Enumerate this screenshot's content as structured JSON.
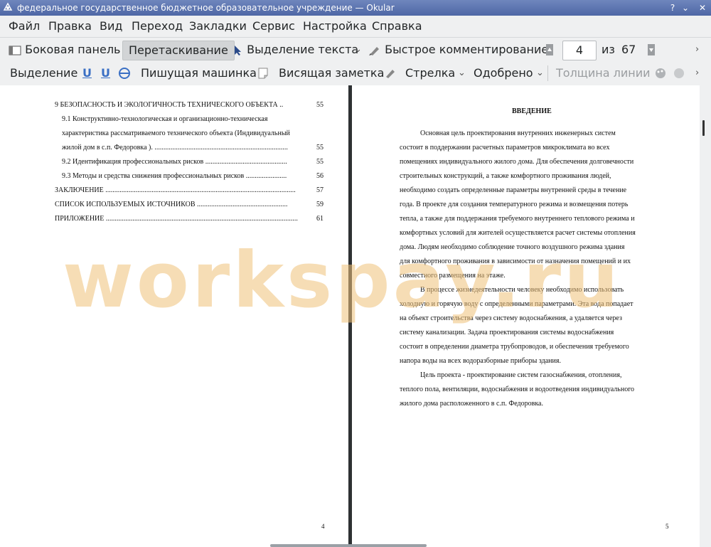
{
  "window": {
    "title": "федеральное государственное бюджетное образовательное учреждение  — Okular"
  },
  "menu": [
    "Файл",
    "Правка",
    "Вид",
    "Переход",
    "Закладки",
    "Сервис",
    "Настройка",
    "Справка"
  ],
  "toolbar1": {
    "sidebar": "Боковая панель",
    "drag": "Перетаскивание",
    "text_select": "Выделение текста",
    "quick_comment": "Быстрое комментирование",
    "page_current": "4",
    "page_of": "из",
    "page_total": "67"
  },
  "toolbar2": {
    "highlight": "Выделение",
    "typewriter": "Пишущая машинка",
    "sticky_note": "Висящая заметка",
    "arrow": "Стрелка",
    "stamp": "Одобрено",
    "line_width": "Толщина линии"
  },
  "left_page": {
    "toc": [
      {
        "text": "9 БЕЗОПАСНОСТЬ И ЭКОЛОГИЧНОСТЬ ТЕХНИЧЕСКОГО ОБЪЕКТА ..",
        "page": "55"
      },
      {
        "text": "9.1 Конструктивно-технологическая и организационно-техническая",
        "page": ""
      },
      {
        "text": "характеристика рассматриваемого технического объекта (Индивидуальный",
        "page": ""
      },
      {
        "text": "жилой дом в с.п. Федоровка ). ...........................................................................",
        "page": "55"
      },
      {
        "text": "9.2 Идентификация профессиональных рисков ..............................................",
        "page": "55"
      },
      {
        "text": "9.3 Методы и средства снижения профессиональных рисков .......................",
        "page": "56"
      },
      {
        "text": "ЗАКЛЮЧЕНИЕ ...........................................................................................................",
        "page": "57"
      },
      {
        "text": "СПИСОК ИСПОЛЬЗУЕМЫХ ИСТОЧНИКОВ ...................................................",
        "page": "59"
      },
      {
        "text": "ПРИЛОЖЕНИЕ ............................................................................................................",
        "page": "61"
      }
    ],
    "page_number": "4"
  },
  "right_page": {
    "heading": "ВВЕДЕНИЕ",
    "lines": [
      "Основная  цель  проектирования  внутренних  инженерных  систем",
      "состоит  в  поддержании  расчетных  параметров  микроклимата  во  всех",
      "помещениях индивидуального жилого дома. Для обеспечения долговечности",
      "строительных  конструкций,  а  также  комфортного  проживания  людей,",
      "необходимо  создать  определенные  параметры  внутренней  среды  в  течение",
      "года. В проекте для создания температурного режима и возмещения потерь",
      "тепла, а также для поддержания требуемого внутреннего теплового режима и",
      "комфортных условий для жителей осуществляется расчет системы отопления",
      "дома. Людям необходимо соблюдение точного воздушного режима здания",
      "для комфортного проживания в зависимости от назначения помещений и их",
      "совместного размещения на этаже.",
      "В  процессе  жизнедеятельности  человеку  необходимо  использовать",
      "холодную и горячую воду с определенными параметрами. Эта вода попадает",
      "на  объект  строительства  через  систему  водоснабжения,  а  удаляется  через",
      "систему  канализации.  Задача  проектирования  системы  водоснабжения",
      "состоит в определении диаметра трубопроводов, и  обеспечения требуемого",
      "напора воды на всех водоразборные приборы здания.",
      "Цель  проекта  -  проектирование  систем  газоснабжения,  отопления,",
      "теплого пола, вентиляции, водоснабжения и водоотведения индивидуального",
      "жилого дома расположенного в с.п. Федоровка."
    ],
    "page_number": "5"
  },
  "watermark": "workspay.ru"
}
